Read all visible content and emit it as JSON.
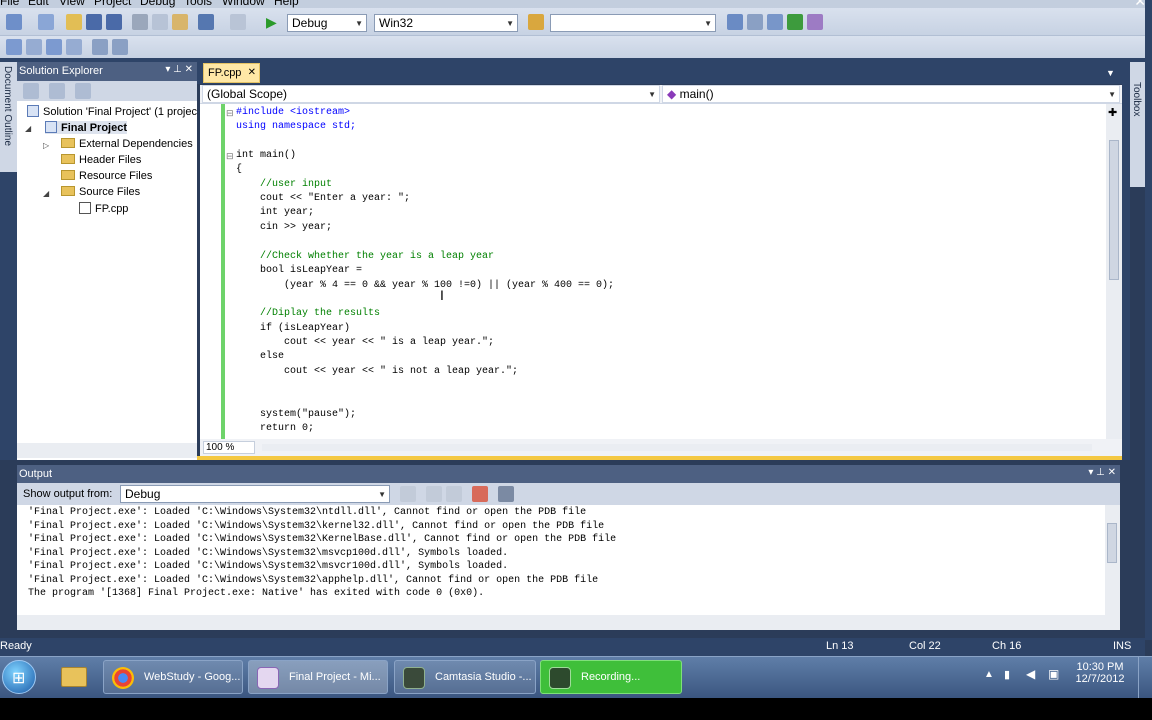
{
  "menubar": {
    "items": [
      "File",
      "Edit",
      "View",
      "Project",
      "Debug",
      "Tools",
      "Window",
      "Help"
    ]
  },
  "toolbar": {
    "config_value": "Debug",
    "platform_value": "Win32",
    "find_value": ""
  },
  "solution_explorer": {
    "title": "Solution Explorer",
    "items": [
      {
        "label": "Solution 'Final Project' (1 projec"
      },
      {
        "label": "Final Project"
      },
      {
        "label": "External Dependencies"
      },
      {
        "label": "Header Files"
      },
      {
        "label": "Resource Files"
      },
      {
        "label": "Source Files"
      },
      {
        "label": "FP.cpp"
      }
    ]
  },
  "side_labels": {
    "document_outline": "Document Outline",
    "toolbox": "Toolbox"
  },
  "editor": {
    "tab_label": "FP.cpp",
    "scope": "(Global Scope)",
    "member": "main()",
    "zoom": "100 %",
    "lines": [
      "#include <iostream>",
      "using namespace std;",
      "",
      "int main()",
      "{",
      "    //user input",
      "    cout << \"Enter a year: \";",
      "    int year;",
      "    cin >> year;",
      "",
      "    //Check whether the year is a leap year",
      "    bool isLeapYear =",
      "        (year % 4 == 0 && year % 100 !=0) || (year % 400 == 0);",
      "",
      "    //Diplay the results",
      "    if (isLeapYear)",
      "        cout << year << \" is a leap year.\";",
      "    else",
      "        cout << year << \" is not a leap year.\";",
      "",
      "",
      "    system(\"pause\");",
      "    return 0;"
    ]
  },
  "output": {
    "title": "Output",
    "show_from_label": "Show output from:",
    "show_from_value": "Debug",
    "lines": [
      "'Final Project.exe': Loaded 'C:\\Windows\\System32\\ntdll.dll', Cannot find or open the PDB file",
      "'Final Project.exe': Loaded 'C:\\Windows\\System32\\kernel32.dll', Cannot find or open the PDB file",
      "'Final Project.exe': Loaded 'C:\\Windows\\System32\\KernelBase.dll', Cannot find or open the PDB file",
      "'Final Project.exe': Loaded 'C:\\Windows\\System32\\msvcp100d.dll', Symbols loaded.",
      "'Final Project.exe': Loaded 'C:\\Windows\\System32\\msvcr100d.dll', Symbols loaded.",
      "'Final Project.exe': Loaded 'C:\\Windows\\System32\\apphelp.dll', Cannot find or open the PDB file",
      "The program '[1368] Final Project.exe: Native' has exited with code 0 (0x0)."
    ]
  },
  "statusbar": {
    "state": "Ready",
    "line": "Ln 13",
    "col": "Col 22",
    "ch": "Ch 16",
    "ins": "INS"
  },
  "taskbar": {
    "buttons": [
      {
        "label": "WebStudy - Goog...",
        "icon": "chrome-icon"
      },
      {
        "label": "Final Project - Mi...",
        "icon": "visual-studio-icon"
      },
      {
        "label": "Camtasia Studio -...",
        "icon": "camtasia-icon"
      },
      {
        "label": "Recording...",
        "icon": "recording-icon"
      }
    ],
    "time": "10:30 PM",
    "date": "12/7/2012"
  },
  "colors": {
    "keyword": "#0000ff",
    "comment": "#008000",
    "string": "#a31515",
    "recording_green": "#3fbf3a"
  }
}
